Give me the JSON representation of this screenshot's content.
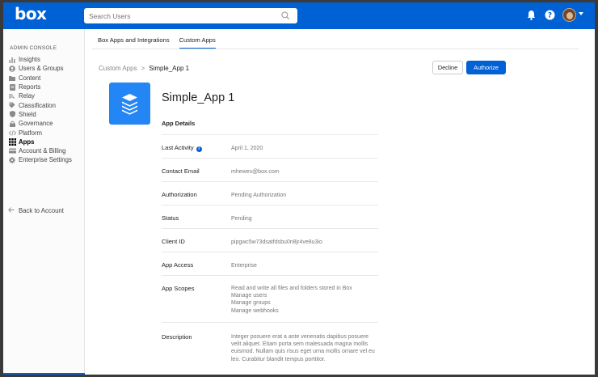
{
  "brand": {
    "logo": "box",
    "accent": "#0061d5"
  },
  "search": {
    "placeholder": "Search Users"
  },
  "topbar": {
    "icons": [
      "bell-icon",
      "help-icon",
      "avatar",
      "chevron-down-icon"
    ]
  },
  "sidebar": {
    "title": "ADMIN CONSOLE",
    "items": [
      {
        "label": "Insights",
        "icon": "insights-icon"
      },
      {
        "label": "Users & Groups",
        "icon": "users-icon"
      },
      {
        "label": "Content",
        "icon": "folder-icon"
      },
      {
        "label": "Reports",
        "icon": "reports-icon"
      },
      {
        "label": "Relay",
        "icon": "relay-icon"
      },
      {
        "label": "Classification",
        "icon": "tag-icon"
      },
      {
        "label": "Shield",
        "icon": "shield-icon"
      },
      {
        "label": "Governance",
        "icon": "lock-icon"
      },
      {
        "label": "Platform",
        "icon": "code-icon"
      },
      {
        "label": "Apps",
        "icon": "grid-icon",
        "active": true
      },
      {
        "label": "Account & Billing",
        "icon": "card-icon"
      },
      {
        "label": "Enterprise Settings",
        "icon": "gear-icon"
      }
    ],
    "back": "Back to Account"
  },
  "tabs": [
    {
      "label": "Box Apps and Integrations"
    },
    {
      "label": "Custom Apps",
      "active": true
    }
  ],
  "breadcrumb": {
    "parent": "Custom Apps",
    "separator": ">",
    "current": "Simple_App 1"
  },
  "actions": {
    "decline": "Decline",
    "authorize": "Authorize"
  },
  "app": {
    "name": "Simple_App 1",
    "details_heading": "App Details",
    "details": [
      {
        "label": "Last Activity",
        "value": "April 1, 2020",
        "info": true
      },
      {
        "label": "Contact Email",
        "value": "mhewes@box.com"
      },
      {
        "label": "Authorization",
        "value": "Pending Authorization"
      },
      {
        "label": "Status",
        "value": "Pending"
      },
      {
        "label": "Client ID",
        "value": "pipgwc5w73dsatfdsbu0n8jr4ve8u3io"
      },
      {
        "label": "App Access",
        "value": "Enterprise"
      },
      {
        "label": "App Scopes",
        "value": [
          "Read and write all files and folders stored in Box",
          "Manage users",
          "Manage groups",
          "Manage webhooks"
        ]
      },
      {
        "label": "Description",
        "value": "Integer posuere erat a ante venenatis dapibus posuere velit aliquet. Etiam porta sem malesuada magna mollis euismod. Nullam quis risus eget urna mollis ornare vel eu leo. Curabitur blandit tempus porttitor."
      }
    ]
  }
}
